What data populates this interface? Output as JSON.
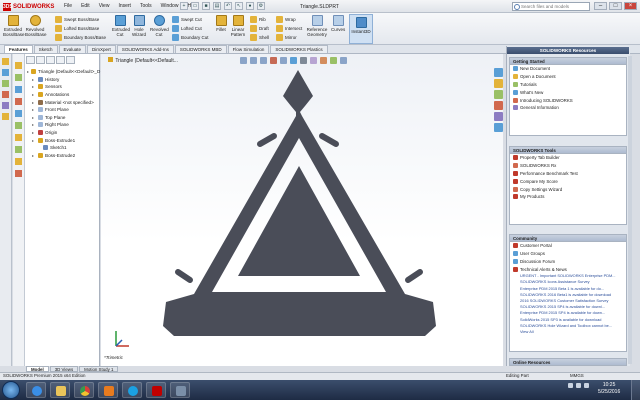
{
  "app": {
    "name": "SOLIDWORKS",
    "doc_title": "Triangle.SLDPRT",
    "search_placeholder": "Search files and models"
  },
  "menu": [
    "File",
    "Edit",
    "View",
    "Insert",
    "Tools",
    "Window",
    "Help"
  ],
  "ribbon": {
    "extruded_boss": "Extruded Boss/Base",
    "revolved_boss": "Revolved Boss/Base",
    "swept_boss": "Swept Boss/Base",
    "lofted_boss": "Lofted Boss/Base",
    "boundary_boss": "Boundary Boss/Base",
    "extruded_cut": "Extruded Cut",
    "hole_wizard": "Hole Wizard",
    "revolved_cut": "Revolved Cut",
    "swept_cut": "Swept Cut",
    "lofted_cut": "Lofted Cut",
    "boundary_cut": "Boundary Cut",
    "fillet": "Fillet",
    "linear_pattern": "Linear Pattern",
    "rib": "Rib",
    "draft": "Draft",
    "shell": "Shell",
    "wrap": "Wrap",
    "intersect": "Intersect",
    "mirror": "Mirror",
    "reference_geometry": "Reference Geometry",
    "curves": "Curves",
    "instant3d": "Instant3D"
  },
  "command_tabs": [
    "Features",
    "Sketch",
    "Evaluate",
    "DimXpert",
    "SOLIDWORKS Add-Ins",
    "SOLIDWORKS MBD",
    "Flow Simulation",
    "SOLIDWORKS Plastics"
  ],
  "feature_tree": [
    {
      "label": "Triangle (Default<<Default>_D",
      "indent": 0,
      "color": "#d9a520"
    },
    {
      "label": "History",
      "indent": 1,
      "color": "#6a8bbf"
    },
    {
      "label": "Sensors",
      "indent": 1,
      "color": "#d9a520"
    },
    {
      "label": "Annotations",
      "indent": 1,
      "color": "#d9a520"
    },
    {
      "label": "Material <not specified>",
      "indent": 1,
      "color": "#8e6c4a"
    },
    {
      "label": "Front Plane",
      "indent": 1,
      "color": "#9fb7d8"
    },
    {
      "label": "Top Plane",
      "indent": 1,
      "color": "#9fb7d8"
    },
    {
      "label": "Right Plane",
      "indent": 1,
      "color": "#9fb7d8"
    },
    {
      "label": "Origin",
      "indent": 1,
      "color": "#c04040"
    },
    {
      "label": "Boss-Extrude1",
      "indent": 1,
      "color": "#d9a520"
    },
    {
      "label": "Sketch1",
      "indent": 2,
      "color": "#6a8bbf"
    },
    {
      "label": "Boss-Extrude2",
      "indent": 1,
      "color": "#d9a520"
    }
  ],
  "graphics": {
    "tree_title": "Triangle (Default<<Default...",
    "view_label": "*Trimetric"
  },
  "task_pane": {
    "title": "SOLIDWORKS Resources",
    "getting_started": {
      "title": "Getting Started",
      "items": [
        "New Document",
        "Open a Document",
        "Tutorials",
        "What's New",
        "Introducing SOLIDWORKS",
        "General Information"
      ]
    },
    "tools": {
      "title": "SOLIDWORKS Tools",
      "items": [
        "Property Tab Builder",
        "SOLIDWORKS Rx",
        "Performance Benchmark Test",
        "Compare My Score",
        "Copy Settings Wizard",
        "My Products"
      ]
    },
    "community": {
      "title": "Community",
      "items": [
        "Customer Portal",
        "User Groups",
        "Discussion Forum",
        "Technical Alerts & News"
      ],
      "news": [
        "URGENT - Important SOLIDWORKS Enterprise PDM...",
        "SOLIDWORKS Icons Assistance Survey",
        "Enterprise PDM 2015 Beta 1 is available for do...",
        "SOLIDWORKS 2016 Beta1 is available for download",
        "2016 SOLIDWORKS Customer Satisfaction Survey",
        "SOLIDWORKS 2015 SP4 is available for downl...",
        "Enterprise PDM 2015 SP4 is available for down...",
        "SolidWorks 2015 SP3 is available for download",
        "SOLIDWORKS Hole Wizard and Toolbox cannot be..."
      ],
      "view_all": "View All"
    },
    "online_resources": "Online Resources"
  },
  "bottom_tabs": [
    "Model",
    "3D Views",
    "Motion Study 1"
  ],
  "status": {
    "edition": "SOLIDWORKS Premium 2015 x64 Edition",
    "mode": "Editing Part",
    "units": "MMGS"
  },
  "clock": {
    "time": "10:25",
    "date": "5/25/2016"
  },
  "colors": {
    "part": "#4a4d58",
    "accent_red": "#c00000",
    "taskbar": "#2a3a57"
  }
}
